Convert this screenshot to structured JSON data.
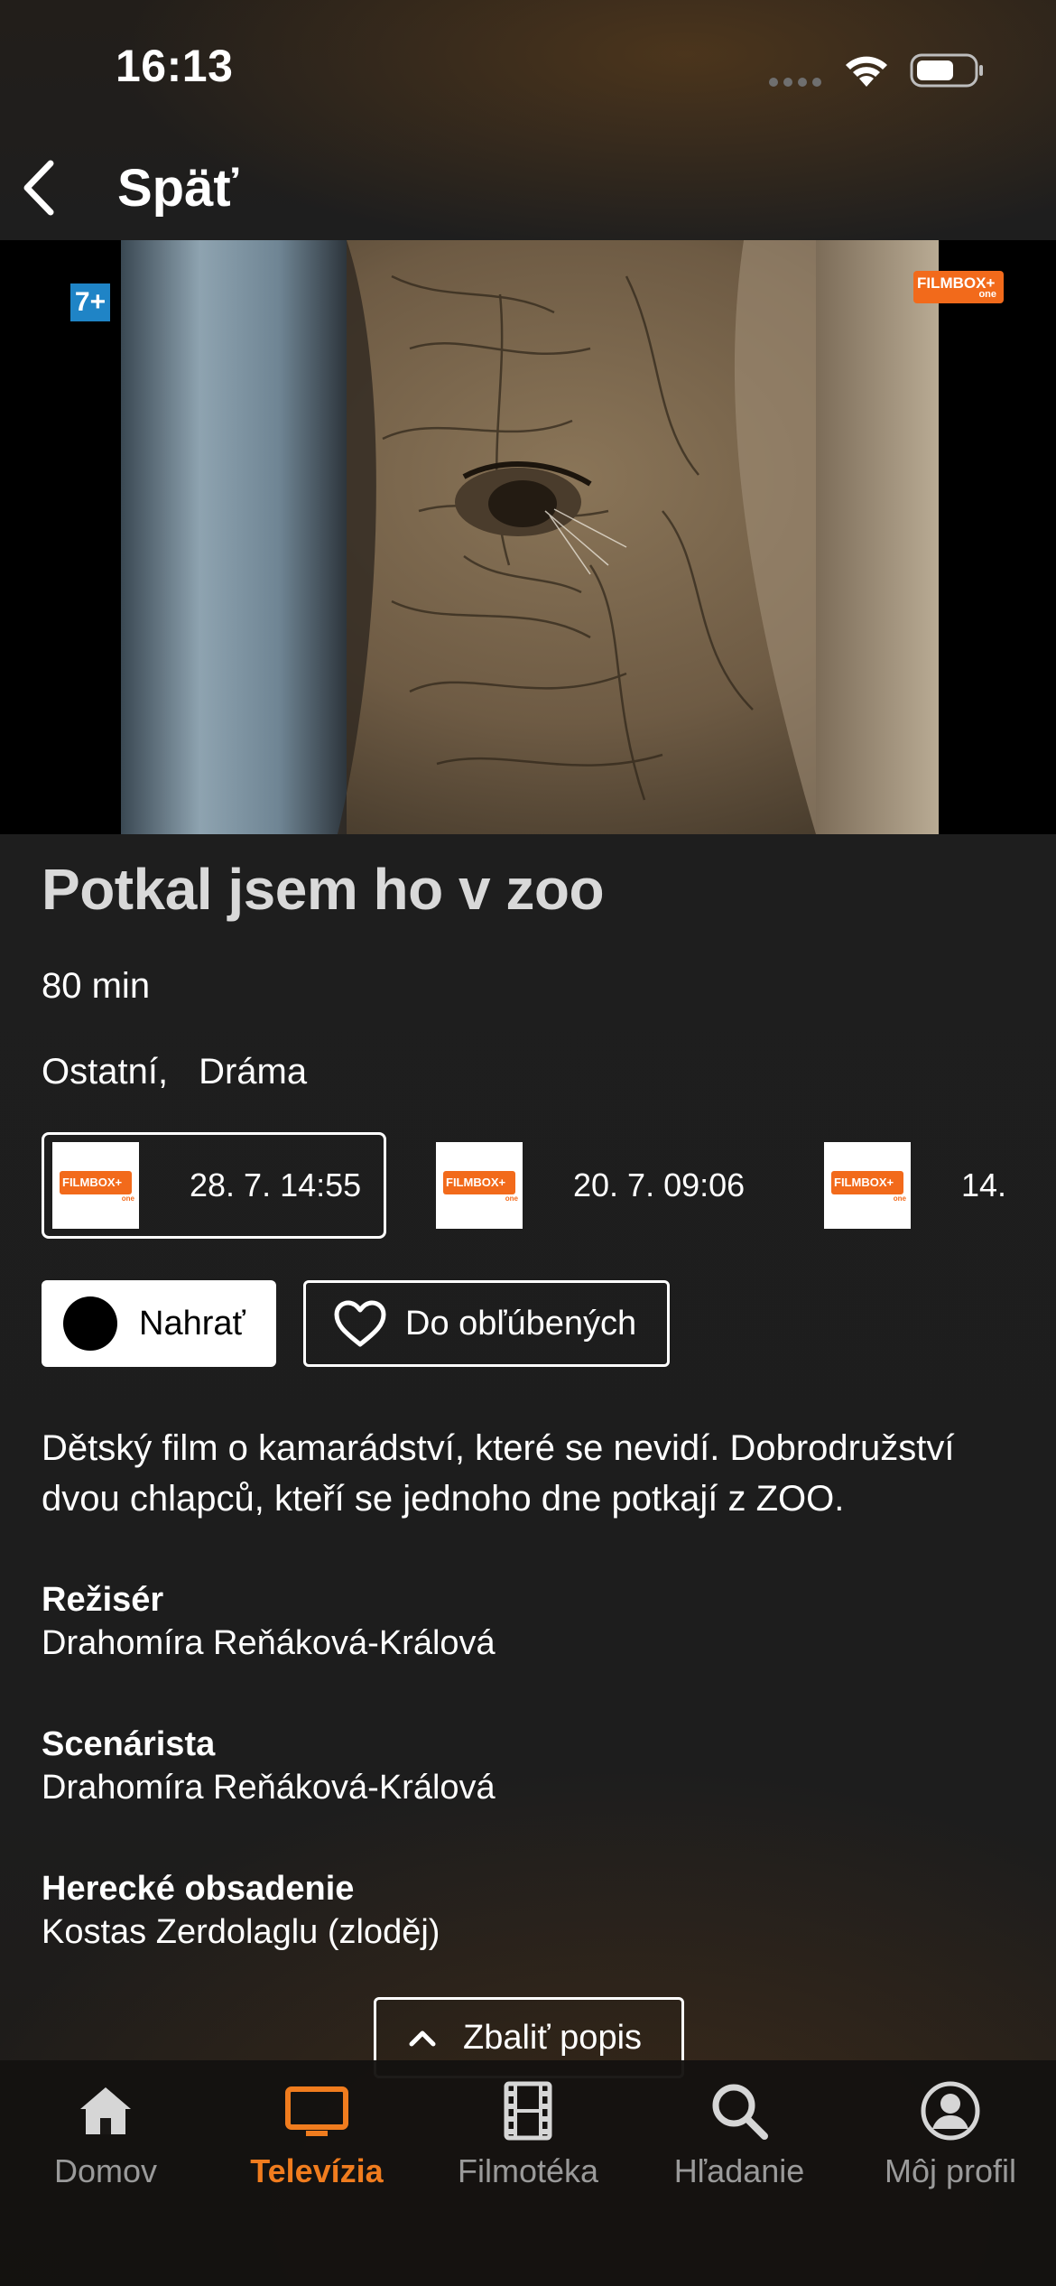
{
  "status_bar": {
    "time": "16:13"
  },
  "header": {
    "back_label": "Späť"
  },
  "video": {
    "age_rating": "7+",
    "channel_watermark": "FILMBOX+",
    "channel_watermark_sub": "one"
  },
  "program": {
    "title": "Potkal jsem ho v zoo",
    "duration": "80 min",
    "genres": [
      "Ostatní,",
      "Dráma"
    ]
  },
  "broadcasts": [
    {
      "channel_logo_text": "FILMBOX+",
      "channel_logo_sub": "one",
      "time": "28. 7. 14:55",
      "selected": true
    },
    {
      "channel_logo_text": "FILMBOX+",
      "channel_logo_sub": "one",
      "time": "20. 7. 09:06",
      "selected": false
    },
    {
      "channel_logo_text": "FILMBOX+",
      "channel_logo_sub": "one",
      "time": "14.",
      "selected": false
    }
  ],
  "actions": {
    "record_label": "Nahrať",
    "favorites_label": "Do obľúbených"
  },
  "description": "Dětský film o kamarádství, které se nevidí. Dobrodružství dvou chlapců, kteří se jednoho dne potkají z ZOO.",
  "credits": [
    {
      "label": "Režisér",
      "value": "Drahomíra Reňáková-Králová"
    },
    {
      "label": "Scenárista",
      "value": "Drahomíra Reňáková-Králová"
    },
    {
      "label": "Herecké obsadenie",
      "value": "Kostas Zerdolaglu (zloděj)"
    }
  ],
  "collapse_label": "Zbaliť popis",
  "tab_bar": {
    "active_color": "#f07c1e",
    "inactive_color": "#9a9a9a",
    "tabs": [
      {
        "label": "Domov",
        "icon": "home-icon"
      },
      {
        "label": "Televízia",
        "icon": "tv-icon",
        "active": true
      },
      {
        "label": "Filmotéka",
        "icon": "film-icon"
      },
      {
        "label": "Hľadanie",
        "icon": "search-icon"
      },
      {
        "label": "Môj profil",
        "icon": "profile-icon"
      }
    ]
  },
  "colors": {
    "accent": "#f07c1e",
    "channel_orange": "#f26a1b",
    "age_badge": "#1f84c6",
    "background": "#1c1c1c"
  }
}
